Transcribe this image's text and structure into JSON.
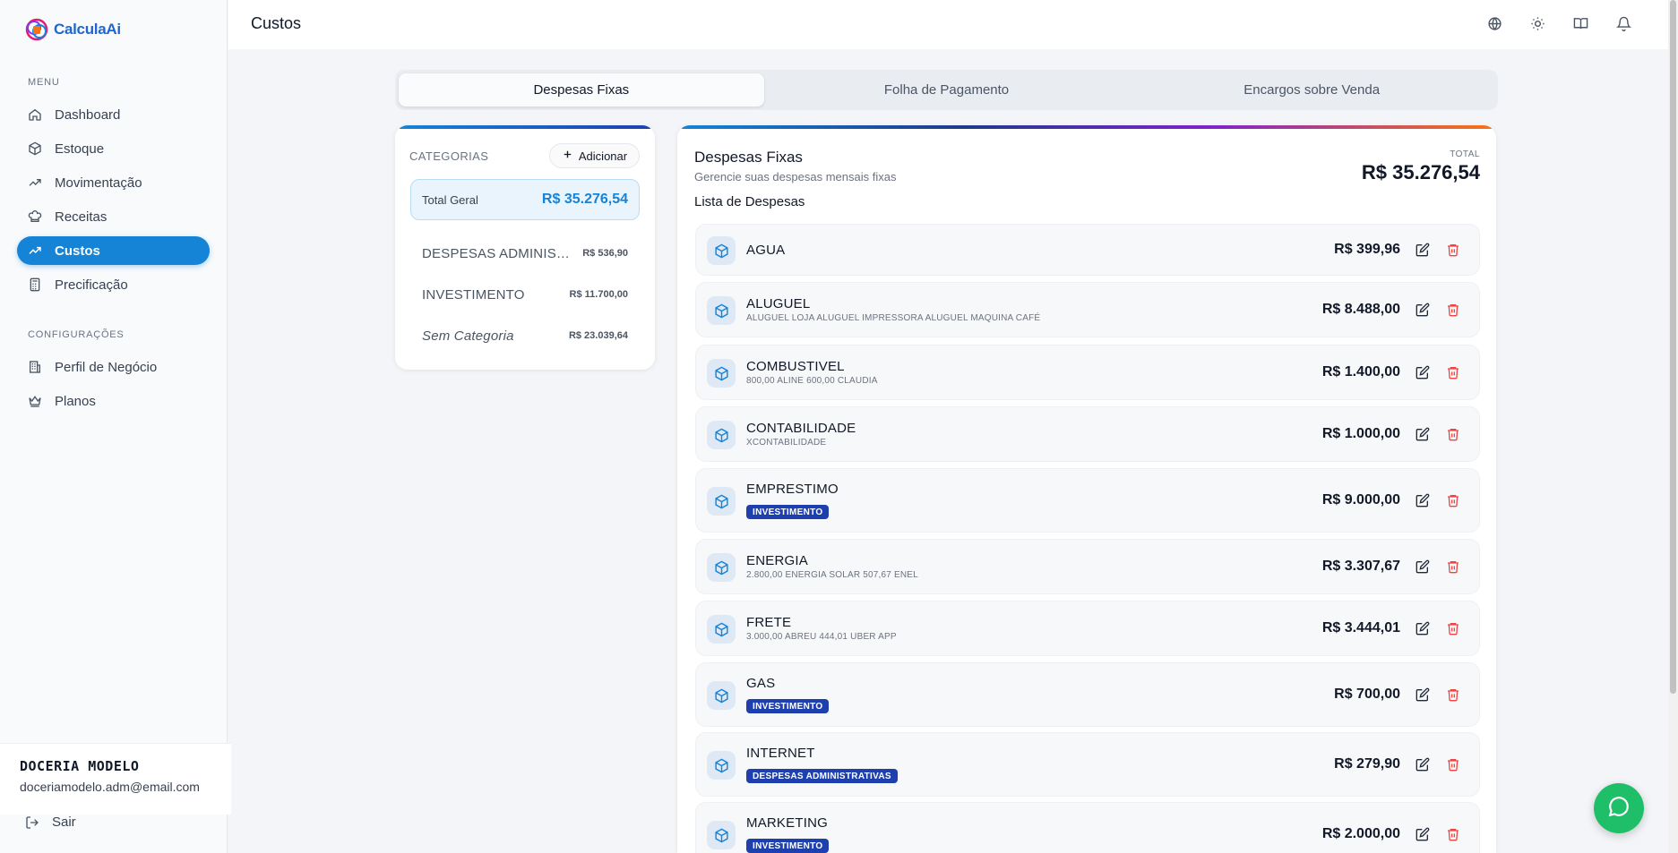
{
  "app": {
    "name": "CalculaAi"
  },
  "sidebar": {
    "menu_label": "MENU",
    "items": [
      {
        "label": "Dashboard",
        "icon": "home-icon"
      },
      {
        "label": "Estoque",
        "icon": "box-icon"
      },
      {
        "label": "Movimentação",
        "icon": "trend-icon"
      },
      {
        "label": "Receitas",
        "icon": "chef-hat-icon"
      },
      {
        "label": "Custos",
        "icon": "trend-icon",
        "active": true
      },
      {
        "label": "Precificação",
        "icon": "calculator-icon"
      }
    ],
    "config_label": "CONFIGURAÇÕES",
    "config_items": [
      {
        "label": "Perfil de Negócio",
        "icon": "building-icon"
      },
      {
        "label": "Planos",
        "icon": "crown-icon"
      }
    ],
    "user": {
      "name": "DOCERIA MODELO",
      "email": "doceriamodelo.adm@email.com"
    },
    "logout_label": "Sair"
  },
  "header": {
    "title": "Custos",
    "icons": [
      "globe-icon",
      "sun-icon",
      "book-icon",
      "bell-icon"
    ]
  },
  "tabs": [
    {
      "label": "Despesas Fixas",
      "active": true
    },
    {
      "label": "Folha de Pagamento"
    },
    {
      "label": "Encargos sobre Venda"
    }
  ],
  "categories": {
    "title": "CATEGORIAS",
    "add_label": "Adicionar",
    "total_label": "Total Geral",
    "total_value": "R$ 35.276,54",
    "items": [
      {
        "name": "DESPESAS ADMINISTRATIVAS",
        "value": "R$ 536,90"
      },
      {
        "name": "INVESTIMENTO",
        "value": "R$ 11.700,00"
      },
      {
        "name": "Sem Categoria",
        "value": "R$ 23.039,64"
      }
    ]
  },
  "expenses": {
    "title": "Despesas Fixas",
    "subtitle": "Gerencie suas despesas mensais fixas",
    "list_title": "Lista de Despesas",
    "total_label": "TOTAL",
    "total_value": "R$ 35.276,54",
    "rows": [
      {
        "name": "AGUA",
        "desc": "",
        "badge": "",
        "value": "R$ 399,96"
      },
      {
        "name": "ALUGUEL",
        "desc": "ALUGUEL LOJA ALUGUEL IMPRESSORA ALUGUEL MAQUINA CAFÉ",
        "badge": "",
        "value": "R$ 8.488,00"
      },
      {
        "name": "COMBUSTIVEL",
        "desc": "800,00 ALINE 600,00 CLAUDIA",
        "badge": "",
        "value": "R$ 1.400,00"
      },
      {
        "name": "CONTABILIDADE",
        "desc": "XCONTABILIDADE",
        "badge": "",
        "value": "R$ 1.000,00"
      },
      {
        "name": "EMPRESTIMO",
        "desc": "",
        "badge": "INVESTIMENTO",
        "value": "R$ 9.000,00"
      },
      {
        "name": "ENERGIA",
        "desc": "2.800,00 ENERGIA SOLAR 507,67 ENEL",
        "badge": "",
        "value": "R$ 3.307,67"
      },
      {
        "name": "FRETE",
        "desc": "3.000,00 ABREU 444,01 UBER APP",
        "badge": "",
        "value": "R$ 3.444,01"
      },
      {
        "name": "GAS",
        "desc": "",
        "badge": "INVESTIMENTO",
        "value": "R$ 700,00"
      },
      {
        "name": "INTERNET",
        "desc": "",
        "badge": "DESPESAS ADMINISTRATIVAS",
        "value": "R$ 279,90"
      },
      {
        "name": "MARKETING",
        "desc": "",
        "badge": "INVESTIMENTO",
        "value": "R$ 2.000,00"
      }
    ]
  },
  "colors": {
    "primary": "#1583d6",
    "badge": "#1e40af",
    "delete": "#ef4444",
    "chat": "#1fbf6a"
  }
}
